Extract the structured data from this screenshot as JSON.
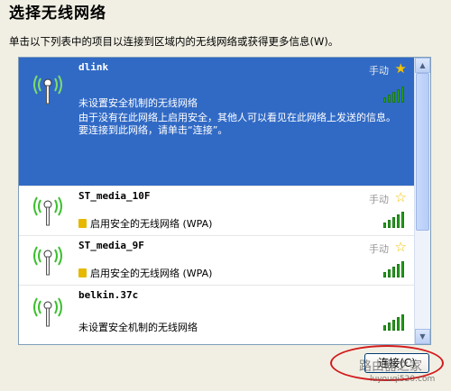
{
  "window": {
    "title": "选择无线网络",
    "instruction": "单击以下列表中的项目以连接到区域内的无线网络或获得更多信息(W)。"
  },
  "networks": [
    {
      "name": "dlink",
      "mode": "手动",
      "security": "未设置安全机制的无线网络",
      "description": "由于没有在此网络上启用安全，其他人可以看见在此网络上发送的信息。要连接到此网络，请单击“连接”。",
      "signal_bars": 5,
      "selected": true
    },
    {
      "name": "ST_media_10F",
      "mode": "手动",
      "security": "启用安全的无线网络 (WPA)",
      "signal_bars": 5,
      "selected": false
    },
    {
      "name": "ST_media_9F",
      "mode": "手动",
      "security": "启用安全的无线网络 (WPA)",
      "signal_bars": 5,
      "selected": false
    },
    {
      "name": "belkin.37c",
      "mode": "",
      "security": "未设置安全机制的无线网络",
      "signal_bars": 5,
      "selected": false
    }
  ],
  "buttons": {
    "connect": "连接(C)"
  },
  "watermark": {
    "text": "路由器之家",
    "url": "luyouqi520.com"
  },
  "colors": {
    "selection": "#316ac5",
    "signal": "#2aa020",
    "star": "#f2c200",
    "ring": "#d21c1c"
  },
  "icons": {
    "network": "wireless-antenna-icon",
    "favorite": "star-icon",
    "lock": "lock-icon",
    "signal": "signal-strength-icon"
  }
}
